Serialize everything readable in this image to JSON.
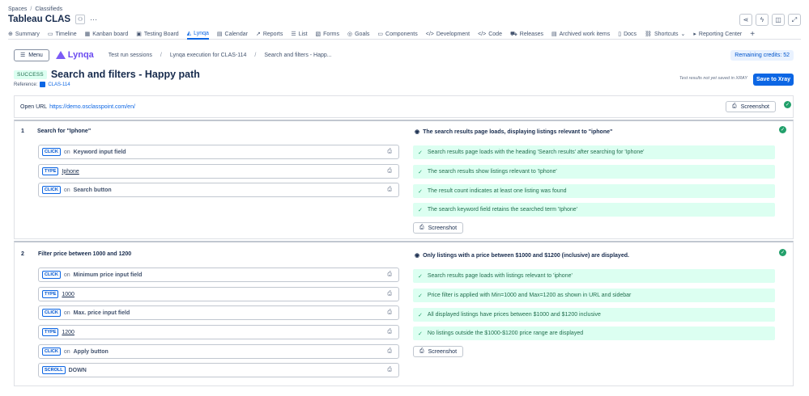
{
  "breadcrumb": {
    "spaces": "Spaces",
    "sep": "/",
    "space": "Classifieds"
  },
  "project_title": "Tableau CLAS",
  "tabs": [
    {
      "icon": "⊕",
      "label": "Summary"
    },
    {
      "icon": "▭",
      "label": "Timeline"
    },
    {
      "icon": "▦",
      "label": "Kanban board"
    },
    {
      "icon": "▣",
      "label": "Testing Board"
    },
    {
      "icon": "◭",
      "label": "Lynqa"
    },
    {
      "icon": "▤",
      "label": "Calendar"
    },
    {
      "icon": "↗",
      "label": "Reports"
    },
    {
      "icon": "☰",
      "label": "List"
    },
    {
      "icon": "▧",
      "label": "Forms"
    },
    {
      "icon": "◎",
      "label": "Goals"
    },
    {
      "icon": "▭",
      "label": "Components"
    },
    {
      "icon": "</>",
      "label": "Development"
    },
    {
      "icon": "</>",
      "label": "Code"
    },
    {
      "icon": "⛟",
      "label": "Releases"
    },
    {
      "icon": "▤",
      "label": "Archived work items"
    },
    {
      "icon": "▯",
      "label": "Docs"
    },
    {
      "icon": "⛓",
      "label": "Shortcuts"
    },
    {
      "icon": "▸",
      "label": "Reporting Center"
    }
  ],
  "lynqa": {
    "menu_label": "Menu",
    "logo_text": "Lynqa",
    "crumbs": [
      "Test run sessions",
      "Lynqa execution for CLAS-114",
      "Search and filters - Happ..."
    ],
    "credits": "Remaining credits: 52"
  },
  "execution": {
    "status": "SUCCESS",
    "title": "Search and filters - Happy path",
    "reference_label": "Reference:",
    "reference_key": "CLAS-114",
    "not_saved_note": "Test results not yet saved in XRAY",
    "save_label": "Save to Xray"
  },
  "open_url": {
    "label": "Open URL",
    "url": "https://demo.osclasspoint.com/en/",
    "screenshot_label": "Screenshot"
  },
  "steps": [
    {
      "number": "1",
      "title": "Search for \"Iphone\"",
      "actions": [
        {
          "kw": "CLICK",
          "on": "on",
          "target": "Keyword input field"
        },
        {
          "kw": "TYPE",
          "value": "Iphone"
        },
        {
          "kw": "CLICK",
          "on": "on",
          "target": "Search button"
        }
      ],
      "expected": "The search results page loads, displaying listings relevant to \"iphone\"",
      "results": [
        "Search results page loads with the heading 'Search results' after searching for 'Iphone'",
        "The search results show listings relevant to 'Iphone'",
        "The result count indicates at least one listing was found",
        "The search keyword field retains the searched term 'Iphone'"
      ],
      "screenshot_label": "Screenshot"
    },
    {
      "number": "2",
      "title": "Filter price between 1000 and 1200",
      "actions": [
        {
          "kw": "CLICK",
          "on": "on",
          "target": "Minimum price input field"
        },
        {
          "kw": "TYPE",
          "value": "1000"
        },
        {
          "kw": "CLICK",
          "on": "on",
          "target": "Max. price input field"
        },
        {
          "kw": "TYPE",
          "value": "1200"
        },
        {
          "kw": "CLICK",
          "on": "on",
          "target": "Apply button"
        },
        {
          "kw": "SCROLL",
          "value": "DOWN"
        }
      ],
      "expected": "Only listings with a price between $1000 and $1200 (inclusive) are displayed.",
      "results": [
        "Search results page loads with listings relevant to 'iphone'",
        "Price filter is applied with Min=1000 and Max=1200 as shown in URL and sidebar",
        "All displayed listings have prices between $1000 and $1200 inclusive",
        "No listings outside the $1000-$1200 price range are displayed"
      ],
      "screenshot_label": "Screenshot"
    }
  ],
  "colors": {
    "accent": "#0c66e4",
    "success_bg": "#dcfff1",
    "success_text": "#216e4e",
    "brand": "#6c4cf0"
  }
}
